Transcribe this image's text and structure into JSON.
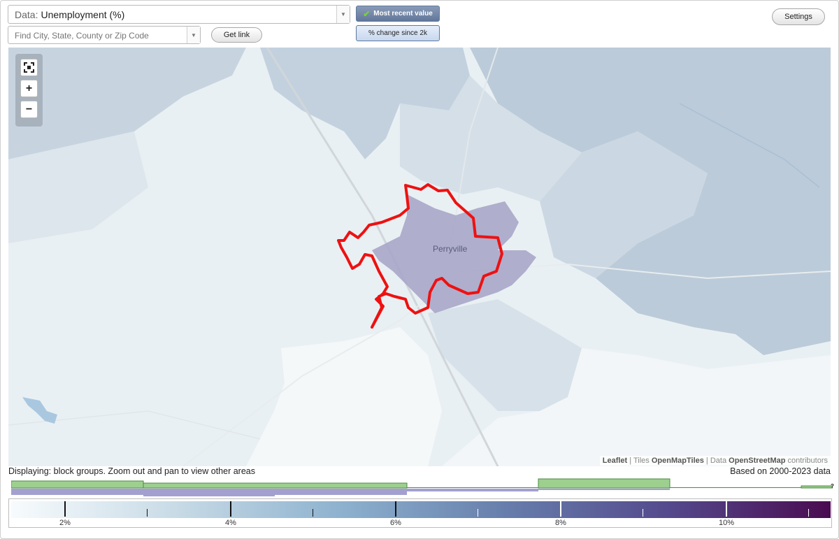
{
  "data_select": {
    "label": "Data:",
    "value": "Unemployment (%)"
  },
  "search": {
    "placeholder": "Find City, State, County or Zip Code"
  },
  "buttons": {
    "get_link": "Get link",
    "settings": "Settings"
  },
  "mode_toggle": {
    "most_recent": "Most recent value",
    "change": "% change since 2k",
    "active": "most_recent"
  },
  "map": {
    "place_label": "Perryville",
    "selection_outline_color": "#ee1111",
    "highlight_fill": "#a9a6c9"
  },
  "attribution": {
    "leaflet": "Leaflet",
    "sep1": "|",
    "tiles": "Tiles",
    "tiles_src": "OpenMapTiles",
    "sep2": "|",
    "data": "Data",
    "data_src": "OpenStreetMap",
    "contrib": "contributors"
  },
  "status": {
    "displaying": "Displaying: block groups. Zoom out and pan to view other areas",
    "based_on": "Based on 2000-2023 data"
  },
  "histogram_unknown": "?",
  "legend": {
    "colors": {
      "low": "#f7fbfd",
      "high": "#4a0b50"
    },
    "labels": [
      "2%",
      "4%",
      "6%",
      "8%",
      "10%"
    ]
  },
  "icons": {
    "fullscreen": "fullscreen-icon",
    "zoom_in": "plus-icon",
    "zoom_out": "minus-icon",
    "check": "check-icon",
    "dropdown": "chevron-down-icon"
  }
}
